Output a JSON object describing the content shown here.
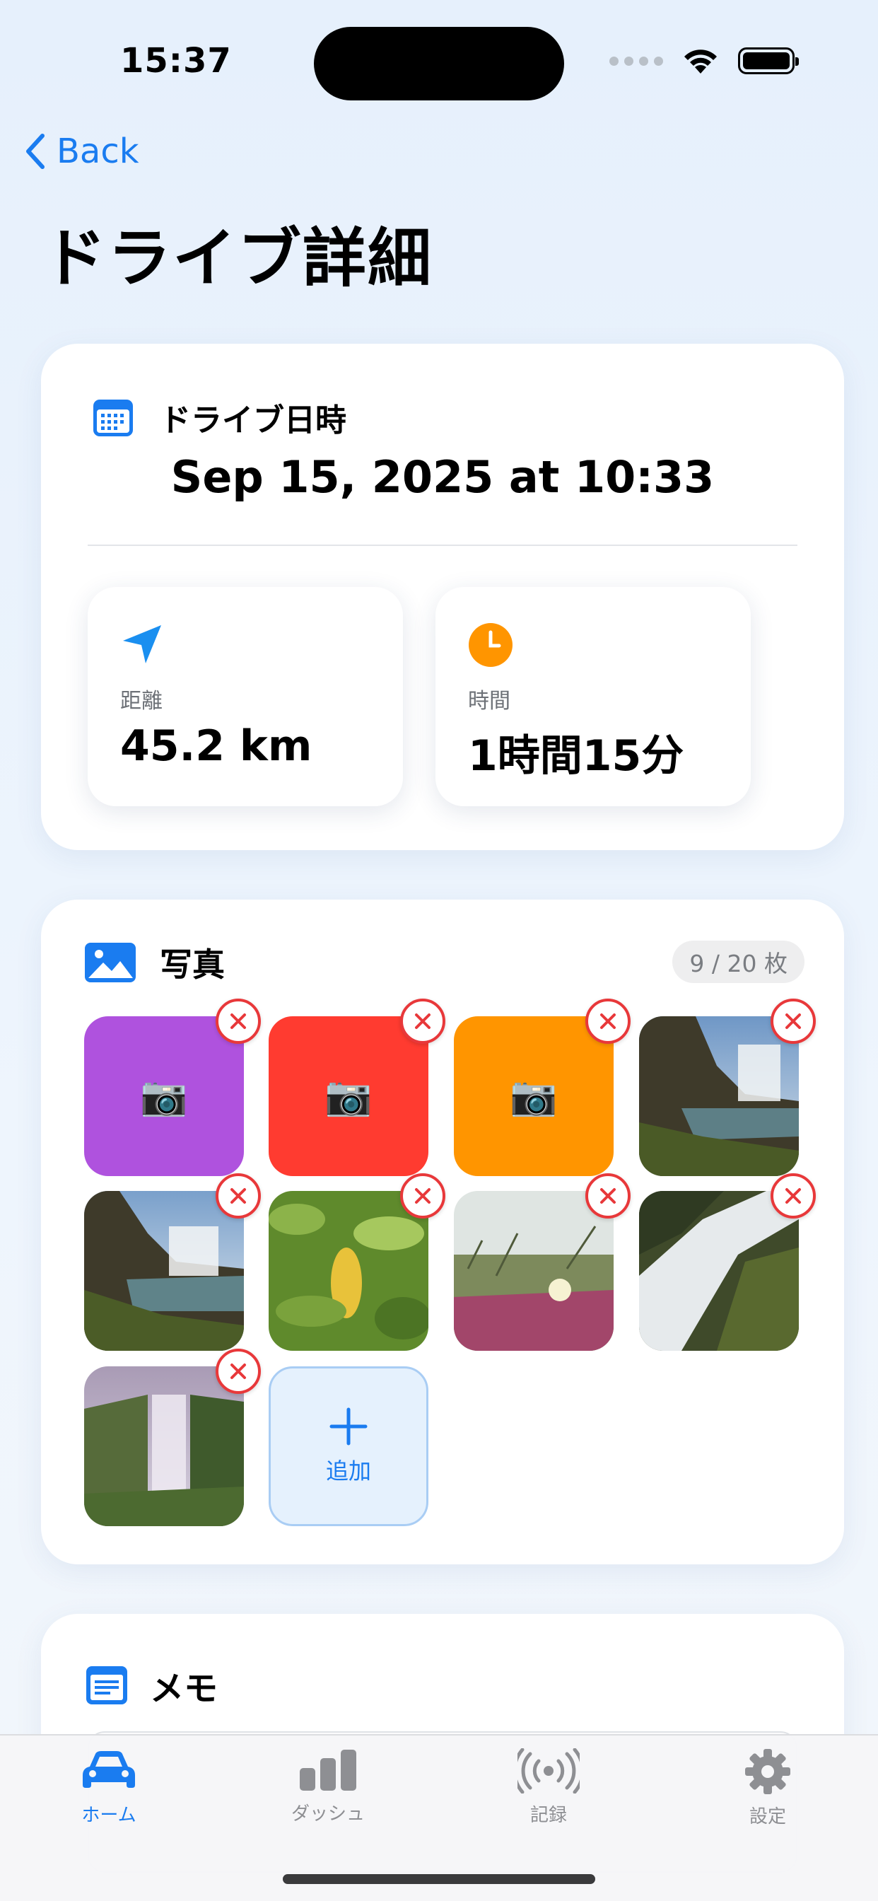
{
  "status_bar": {
    "time": "15:37"
  },
  "nav": {
    "back_label": "Back",
    "title": "ドライブ詳細"
  },
  "datetime_card": {
    "label": "ドライブ日時",
    "value": "Sep 15, 2025 at 10:33",
    "distance": {
      "label": "距離",
      "value": "45.2 km"
    },
    "duration": {
      "label": "時間",
      "value": "1時間15分"
    }
  },
  "photos_card": {
    "label": "写真",
    "count": "9 / 20 枚",
    "tiles": [
      {
        "kind": "placeholder",
        "color": "#af52de",
        "glyph": "📷"
      },
      {
        "kind": "placeholder",
        "color": "#ff3b30",
        "glyph": "📷"
      },
      {
        "kind": "placeholder",
        "color": "#ff9500",
        "glyph": "📷"
      },
      {
        "kind": "photo",
        "subject": "waterfall-cliff"
      },
      {
        "kind": "photo",
        "subject": "waterfall-cliff"
      },
      {
        "kind": "photo",
        "subject": "leaves"
      },
      {
        "kind": "photo",
        "subject": "flowers-grass"
      },
      {
        "kind": "photo",
        "subject": "waterfall-closeup"
      },
      {
        "kind": "photo",
        "subject": "waterfall-misty"
      }
    ],
    "add_label": "追加"
  },
  "memo_card": {
    "label": "メモ"
  },
  "tab_bar": {
    "items": [
      {
        "label": "ホーム",
        "active": true
      },
      {
        "label": "ダッシュ",
        "active": false
      },
      {
        "label": "記録",
        "active": false
      },
      {
        "label": "設定",
        "active": false
      }
    ]
  },
  "colors": {
    "accent": "#1a7cf0",
    "remove": "#e8383a",
    "orange": "#ff9500"
  }
}
